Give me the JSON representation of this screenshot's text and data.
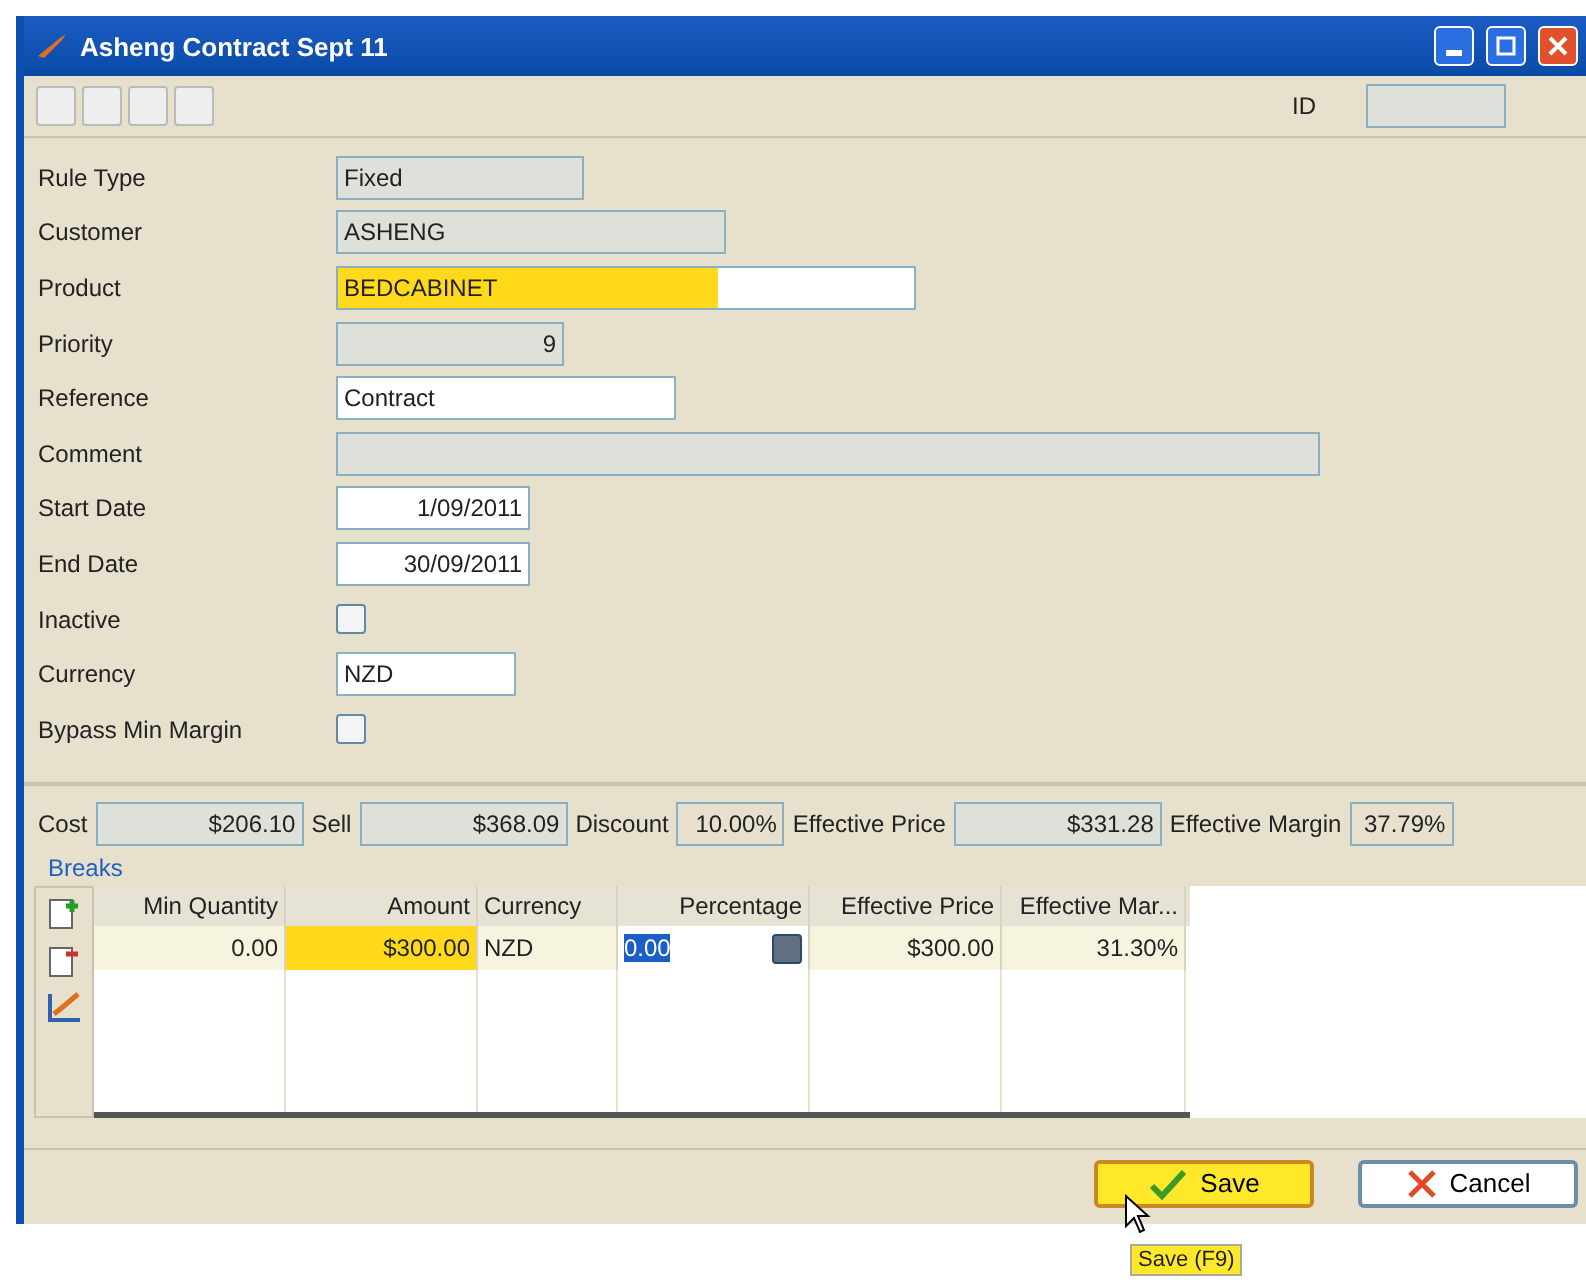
{
  "window": {
    "title": "Asheng Contract Sept 11"
  },
  "toolbar": {
    "id_label": "ID"
  },
  "fields": [
    {
      "label": "Rule Type",
      "kind": "text",
      "value": "Fixed",
      "readonly": true,
      "highlighted": false
    },
    {
      "label": "Customer",
      "kind": "text",
      "value": "ASHENG",
      "readonly": true,
      "highlighted": false
    },
    {
      "label": "Product",
      "kind": "text",
      "value": "BEDCABINET",
      "readonly": false,
      "highlighted": true
    },
    {
      "label": "Priority",
      "kind": "number",
      "value": "9",
      "readonly": true,
      "highlighted": false
    },
    {
      "label": "Reference",
      "kind": "text",
      "value": "Contract",
      "readonly": false,
      "highlighted": false
    },
    {
      "label": "Comment",
      "kind": "text",
      "readonly": true,
      "highlighted": false
    },
    {
      "label": "Start Date",
      "kind": "date",
      "value": "1/09/2011",
      "readonly": false,
      "highlighted": false
    },
    {
      "label": "End Date",
      "kind": "date",
      "value": "30/09/2011",
      "readonly": false,
      "highlighted": false
    },
    {
      "label": "Inactive",
      "kind": "checkbox",
      "checked": false
    },
    {
      "label": "Currency",
      "kind": "text",
      "value": "NZD",
      "readonly": false,
      "highlighted": false
    },
    {
      "label": "Bypass Min Margin",
      "kind": "checkbox",
      "checked": false
    }
  ],
  "summary": [
    {
      "label": "Cost",
      "value": "$206.10"
    },
    {
      "label": "Sell",
      "value": "$368.09"
    },
    {
      "label": "Discount",
      "value": "10.00%"
    },
    {
      "label": "Effective Price",
      "value": "$331.28"
    },
    {
      "label": "Effective Margin",
      "value": "37.79%"
    }
  ],
  "breaks": {
    "title": "Breaks",
    "columns": [
      "Min Quantity",
      "Amount",
      "Currency",
      "Percentage",
      "Effective Price",
      "Effective Mar..."
    ],
    "rows": [
      {
        "cells": [
          {
            "value": "0.00",
            "highlighted": false,
            "editing": false
          },
          {
            "value": "$300.00",
            "highlighted": true,
            "editing": false
          },
          {
            "value": "NZD",
            "highlighted": false,
            "editing": false
          },
          {
            "value": "0.00",
            "highlighted": false,
            "editing": true
          },
          {
            "value": "$300.00",
            "highlighted": false,
            "editing": false
          },
          {
            "value": "31.30%",
            "highlighted": false,
            "editing": false
          }
        ]
      }
    ]
  },
  "buttons": [
    {
      "label": "Save",
      "kind": "save",
      "focused": true
    },
    {
      "label": "Cancel",
      "kind": "cancel",
      "focused": false
    }
  ],
  "tooltip": "Save (F9)"
}
